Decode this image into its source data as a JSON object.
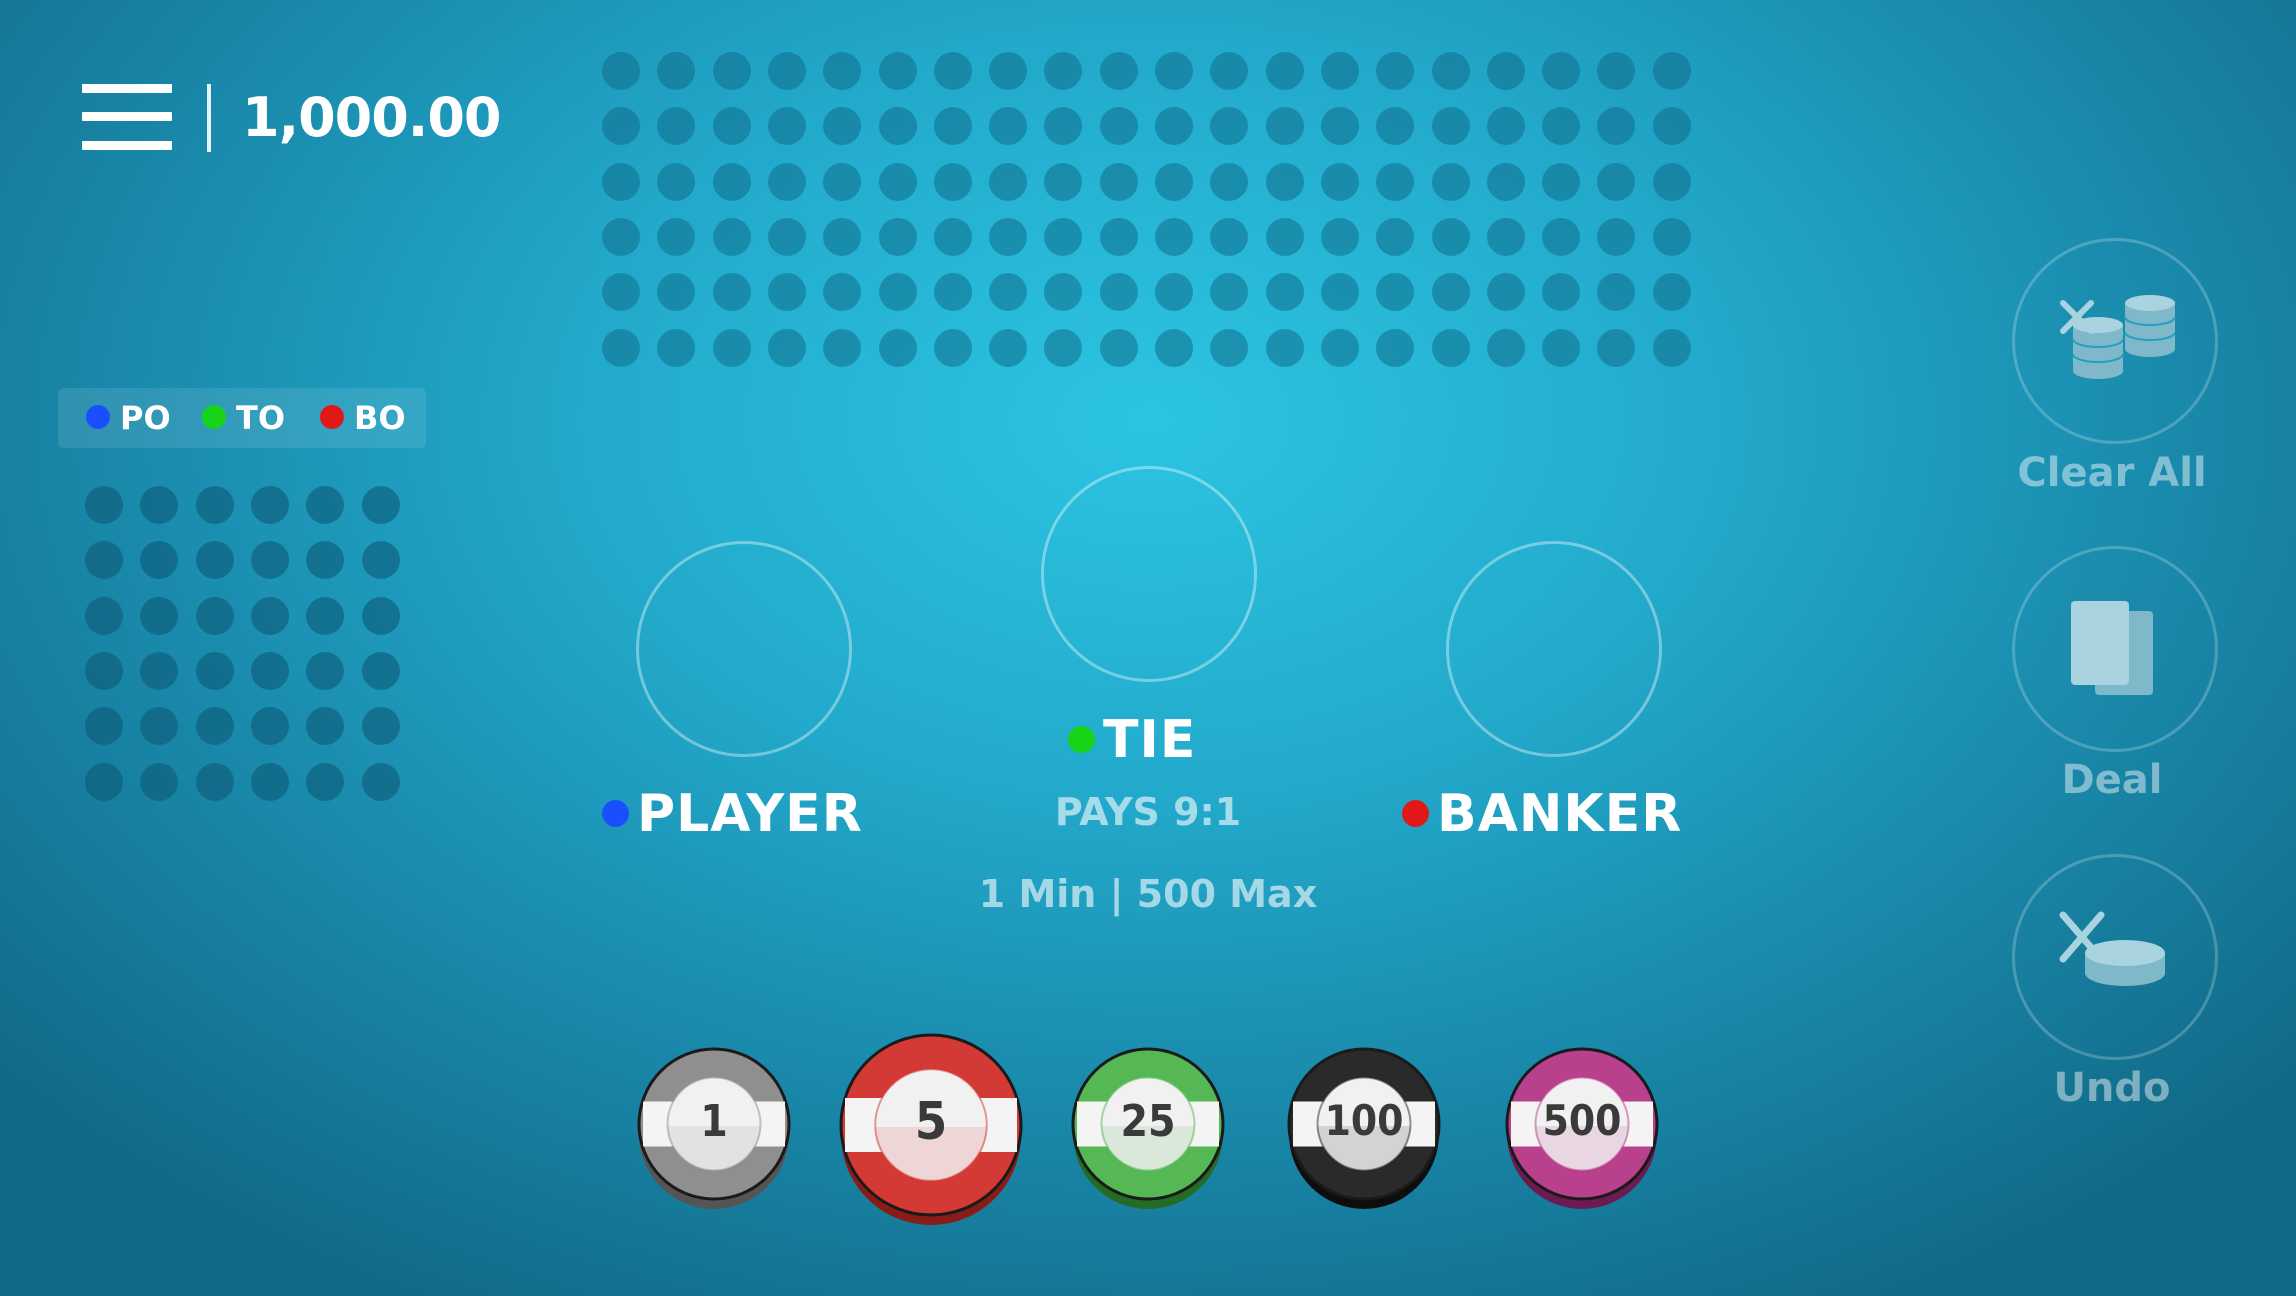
{
  "header": {
    "menu_icon": "hamburger-menu-icon",
    "balance": "1,000.00"
  },
  "legend": [
    {
      "label": "PO",
      "color": "#1a4fff"
    },
    {
      "label": "TO",
      "color": "#18d418"
    },
    {
      "label": "BO",
      "color": "#e01818"
    }
  ],
  "bets": {
    "player": {
      "label": "PLAYER",
      "color": "#1a4fff"
    },
    "tie": {
      "label": "TIE",
      "color": "#18d418",
      "pays": "PAYS 9:1"
    },
    "banker": {
      "label": "BANKER",
      "color": "#e01818"
    },
    "limits": "1 Min | 500 Max"
  },
  "actions": {
    "clear_all": {
      "label": "Clear All",
      "icon": "clear-chips-icon"
    },
    "deal": {
      "label": "Deal",
      "icon": "cards-icon"
    },
    "undo": {
      "label": "Undo",
      "icon": "undo-chip-icon"
    }
  },
  "chips": [
    {
      "value": "1",
      "color": "#8f8f8f",
      "dark": "#555555",
      "selected": false
    },
    {
      "value": "5",
      "color": "#d43a35",
      "dark": "#8a1c18",
      "selected": true
    },
    {
      "value": "25",
      "color": "#55b855",
      "dark": "#246b24",
      "selected": false
    },
    {
      "value": "100",
      "color": "#2a2a2a",
      "dark": "#0d0d0d",
      "selected": false
    },
    {
      "value": "500",
      "color": "#b8408c",
      "dark": "#6d1a52",
      "selected": false
    }
  ]
}
